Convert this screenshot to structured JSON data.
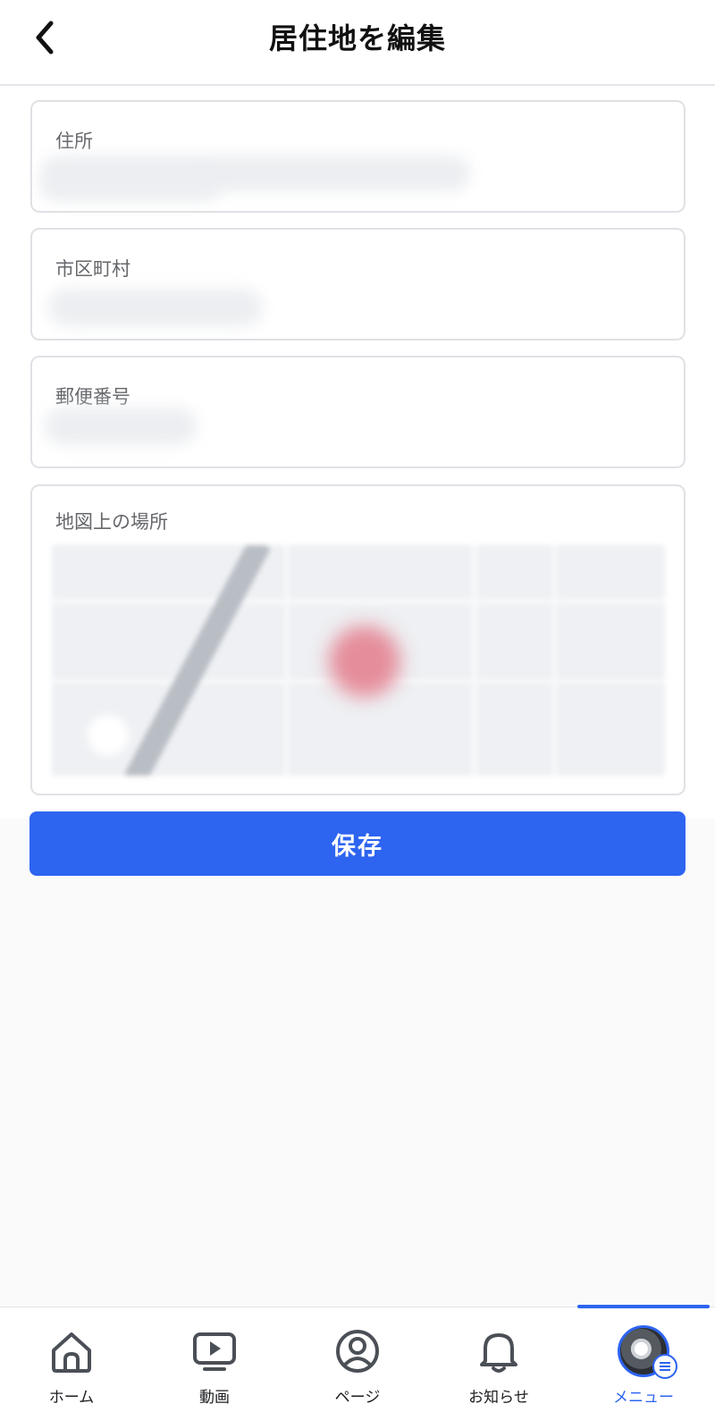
{
  "header": {
    "title": "居住地を編集",
    "back_icon": "chevron-left-icon"
  },
  "fields": {
    "address_label": "住所",
    "city_label": "市区町村",
    "postal_label": "郵便番号",
    "map_label": "地図上の場所"
  },
  "actions": {
    "save_label": "保存"
  },
  "tabbar": {
    "tabs": [
      {
        "label": "ホーム",
        "icon": "home-icon"
      },
      {
        "label": "動画",
        "icon": "video-icon"
      },
      {
        "label": "ページ",
        "icon": "user-circle-icon"
      },
      {
        "label": "お知らせ",
        "icon": "bell-icon"
      },
      {
        "label": "メニュー",
        "icon": "avatar-menu-icon"
      }
    ],
    "active_tab": "メニュー"
  },
  "colors": {
    "accent": "#2d64f0",
    "background": "#fafafb",
    "field_border": "#dfe1e5",
    "label": "#65676b"
  }
}
